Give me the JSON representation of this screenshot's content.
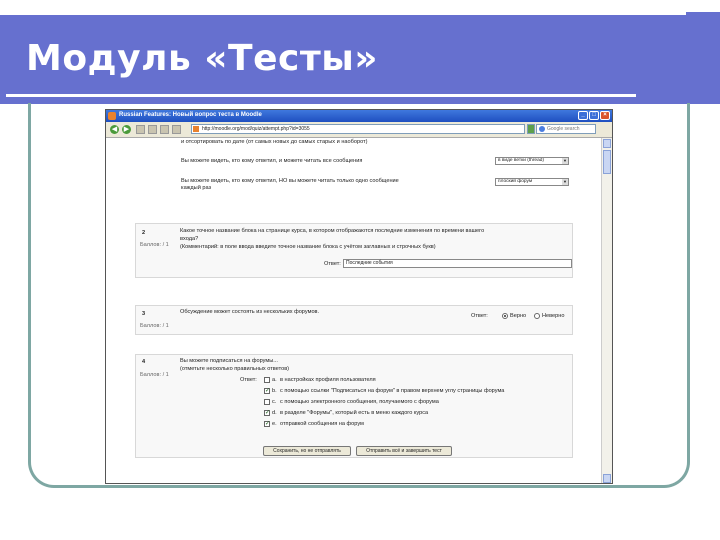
{
  "slide": {
    "title": "Модуль «Тесты»"
  },
  "browser": {
    "window_title": "Russian Features: Новый вопрос теста в Moodle",
    "address": "http://moodle.org/mod/quiz/attempt.php?id=3055",
    "search_placeholder": "Google search"
  },
  "quiz": {
    "q1_partial": {
      "line1": "и отсортировать по дате (от самых новых до самых старых и наоборот)",
      "row1_text": "Вы можете видеть, кто кому ответил, и можете читать все сообщения",
      "row1_select": "в виде ветки (thread)",
      "row2_text_a": "Вы можете видеть, кто кому ответил, НО вы можете читать только одно сообщение",
      "row2_text_b": "каждый раз",
      "row2_select": "плоский форум"
    },
    "q2": {
      "number": "2",
      "grade_label": "Баллов: / 1",
      "text_a": "Какое точное название блока на странице курса, в котором отображаются последние изменения по времени вашего",
      "text_b": "входа?",
      "text_c": "(Комментарий: в поле ввода введите точное название блока с учётом заглавных и строчных букв)",
      "answer_label": "Ответ:",
      "answer_value": "Последние события"
    },
    "q3": {
      "number": "3",
      "grade_label": "Баллов: / 1",
      "text": "Обсуждение может состоять из нескольких форумов.",
      "answer_label": "Ответ:",
      "true_label": "Верно",
      "false_label": "Неверно"
    },
    "q4": {
      "number": "4",
      "grade_label": "Баллов: / 1",
      "text_a": "Вы можете подписаться на форумы...",
      "text_b": "(отметьте несколько правильных ответов)",
      "answer_label": "Ответ:",
      "options": [
        {
          "prefix": "a.",
          "text": "в настройках профиля пользователя",
          "checked": false
        },
        {
          "prefix": "b.",
          "text": "с помощью ссылки \"Подписаться на форум\" в правом верхнем углу страницы форума",
          "checked": true
        },
        {
          "prefix": "c.",
          "text": "с помощью электронного сообщения, получаемого с форума",
          "checked": false
        },
        {
          "prefix": "d.",
          "text": "в разделе \"Форумы\", который есть в меню каждого курса",
          "checked": true
        },
        {
          "prefix": "e.",
          "text": "отправкой сообщения на форум",
          "checked": true
        }
      ]
    },
    "buttons": {
      "save": "Сохранить, но не отправлять",
      "submit": "Отправить всё и завершить тест"
    }
  }
}
